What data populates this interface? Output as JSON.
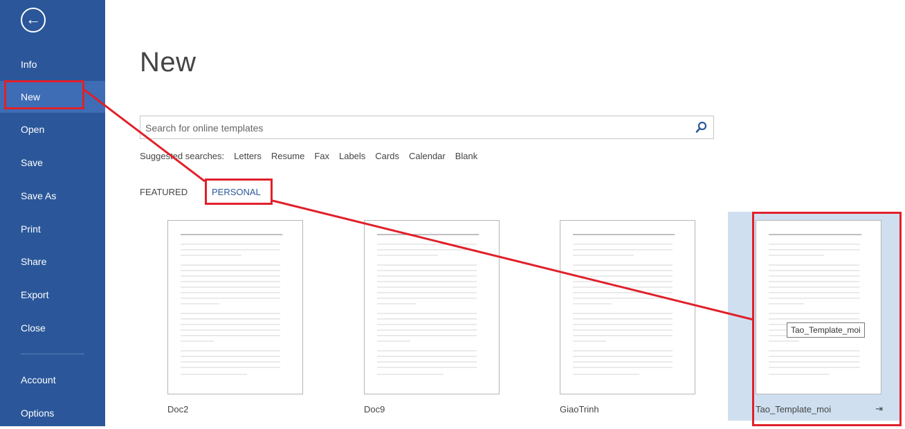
{
  "sidebar": {
    "back_label": "←",
    "items": [
      {
        "label": "Info"
      },
      {
        "label": "New"
      },
      {
        "label": "Open"
      },
      {
        "label": "Save"
      },
      {
        "label": "Save As"
      },
      {
        "label": "Print"
      },
      {
        "label": "Share"
      },
      {
        "label": "Export"
      },
      {
        "label": "Close"
      },
      {
        "label": "Account"
      },
      {
        "label": "Options"
      }
    ],
    "active": "New"
  },
  "main": {
    "title": "New",
    "search": {
      "placeholder": "Search for online templates"
    },
    "suggested": {
      "label": "Suggested searches:",
      "links": [
        "Letters",
        "Resume",
        "Fax",
        "Labels",
        "Cards",
        "Calendar",
        "Blank"
      ]
    },
    "tabs": [
      {
        "label": "FEATURED"
      },
      {
        "label": "PERSONAL"
      }
    ],
    "active_tab": "PERSONAL",
    "templates": [
      {
        "name": "Doc2"
      },
      {
        "name": "Doc9"
      },
      {
        "name": "GiaoTrinh"
      },
      {
        "name": "Tao_Template_moi"
      }
    ],
    "tooltip": "Tao_Template_moi",
    "pin_icon": "pin-icon"
  },
  "colors": {
    "sidebar_bg": "#2b579a",
    "sidebar_active": "#3e6db5",
    "accent": "#2b579a",
    "annotation": "#e0202a",
    "selected_card": "#cfdff0"
  }
}
